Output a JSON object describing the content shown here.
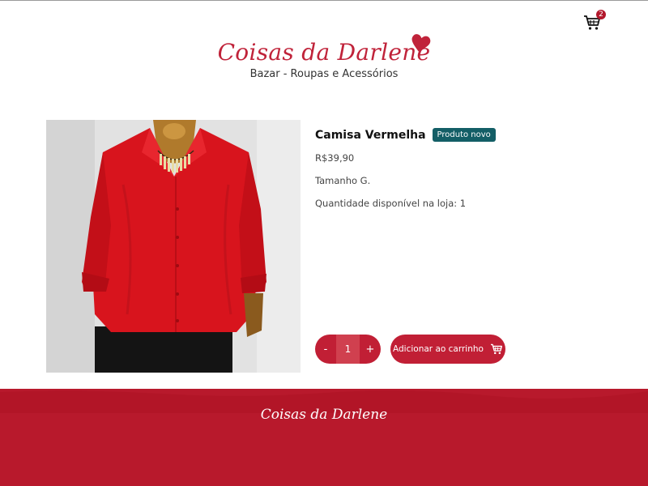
{
  "header": {
    "cart_count": "2",
    "cart_icon": "cart-icon"
  },
  "logo": {
    "title": "Coisas da Darlene",
    "subtitle": "Bazar - Roupas e Acessórios",
    "heart_color": "#c0233a"
  },
  "product": {
    "name": "Camisa Vermelha",
    "badge": "Produto novo",
    "price": "R$39,90",
    "size": "Tamanho G.",
    "stock": "Quantidade disponível na loja: 1",
    "image_icon": "red-shirt-photo"
  },
  "purchase": {
    "decrement_label": "-",
    "quantity": "1",
    "increment_label": "+",
    "add_label": "Adicionar ao carrinho"
  },
  "footer": {
    "title": "Coisas da Darlene"
  },
  "colors": {
    "accent": "#c11f35",
    "badge_bg": "#135e66",
    "footer_bg": "#b8192c"
  }
}
